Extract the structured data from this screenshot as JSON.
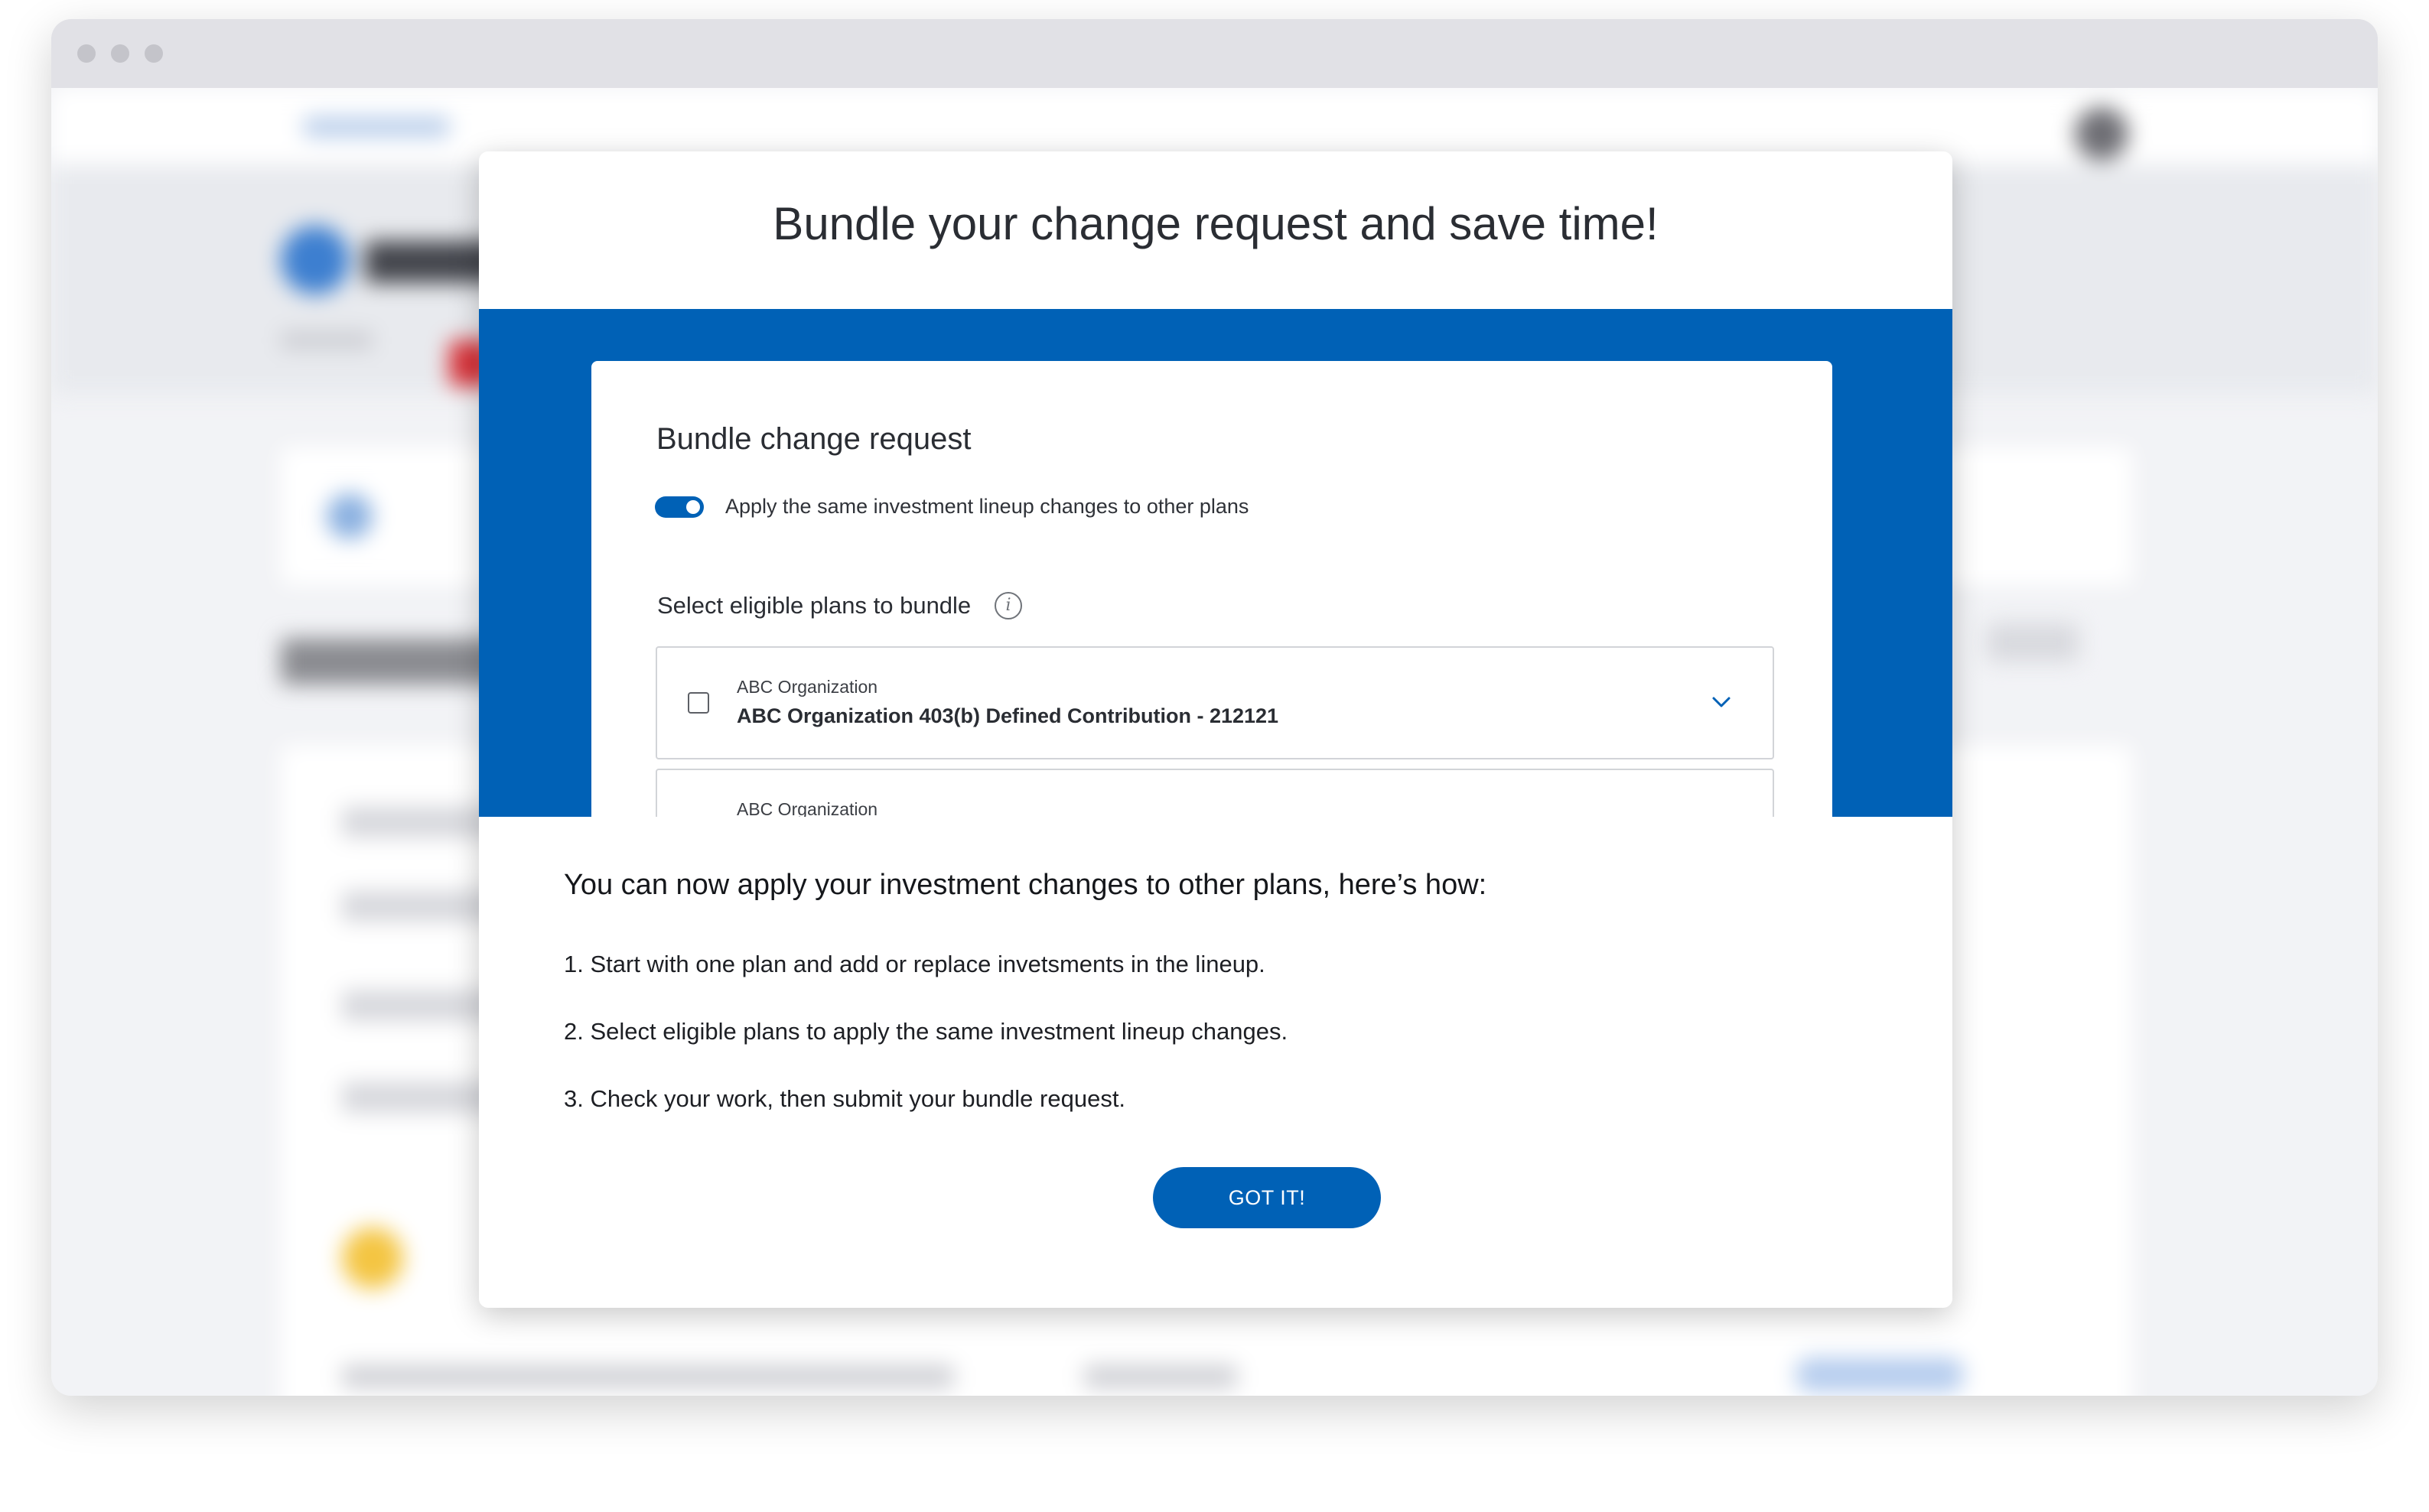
{
  "modal": {
    "title": "Bundle your change request and save time!",
    "preview": {
      "heading": "Bundle change request",
      "toggle_label": "Apply the same investment lineup changes to other plans",
      "toggle_on": true,
      "select_label": "Select eligible plans to bundle",
      "info_icon": "info-icon",
      "plans": [
        {
          "org": "ABC Organization",
          "name": "ABC Organization 403(b) Defined Contribution - 212121"
        },
        {
          "org": "ABC Organization",
          "name": ""
        }
      ]
    },
    "body_heading": "You can now apply your investment changes to other plans, here’s how:",
    "steps": [
      "1. Start with one plan and add or replace invetsments in the lineup.",
      "2. Select eligible plans to apply the same investment lineup changes.",
      "3. Check your work, then submit your bundle request."
    ],
    "button_label": "GOT IT!"
  },
  "colors": {
    "brand_blue": "#0061b6",
    "modal_background": "#ffffff",
    "text_dark": "#2a2d33"
  }
}
